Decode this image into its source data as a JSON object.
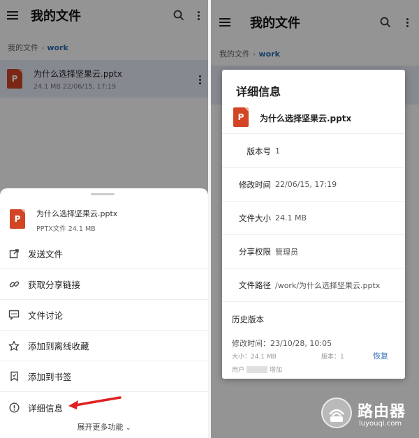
{
  "left": {
    "appbar": {
      "title": "我的文件"
    },
    "breadcrumb": {
      "root": "我的文件",
      "current": "work"
    },
    "file": {
      "name": "为什么选择坚果云.pptx",
      "meta": "24.1 MB 22/06/15, 17:19",
      "icon_letter": "P"
    },
    "sheet": {
      "file_name": "为什么选择坚果云.pptx",
      "file_meta": "PPTX文件 24.1 MB",
      "items": [
        {
          "label": "发送文件",
          "icon": "share-out-icon"
        },
        {
          "label": "获取分享链接",
          "icon": "link-icon"
        },
        {
          "label": "文件讨论",
          "icon": "comment-icon"
        },
        {
          "label": "添加到离线收藏",
          "icon": "star-icon"
        },
        {
          "label": "添加到书签",
          "icon": "bookmark-icon"
        },
        {
          "label": "详细信息",
          "icon": "info-icon"
        }
      ],
      "expand_label": "展开更多功能"
    }
  },
  "right": {
    "appbar": {
      "title": "我的文件"
    },
    "breadcrumb": {
      "root": "我的文件",
      "current": "work"
    },
    "dialog": {
      "title": "详细信息",
      "file_name": "为什么选择坚果云.pptx",
      "rows": [
        {
          "key": "版本号",
          "value": "1"
        },
        {
          "key": "修改时间",
          "value": "22/06/15, 17:19"
        },
        {
          "key": "文件大小",
          "value": "24.1 MB"
        },
        {
          "key": "分享权限",
          "value": "管理员"
        },
        {
          "key": "文件路径",
          "value": "/work/为什么选择坚果云.pptx"
        }
      ],
      "history": {
        "title": "历史版本",
        "modified": "修改时间：23/10/28, 10:05",
        "size": "大小：24.1 MB",
        "version": "版本：1",
        "restore": "恢复",
        "user_prefix": "用户",
        "user_suffix": "增加"
      }
    }
  },
  "watermark": {
    "main": "路由器",
    "sub": "luyouqi.com"
  },
  "colors": {
    "accent": "#2f6fb5",
    "ppt": "#d24625",
    "highlight": "#e7eef8",
    "arrow": "#e02020",
    "fab": "#1b66b8"
  }
}
